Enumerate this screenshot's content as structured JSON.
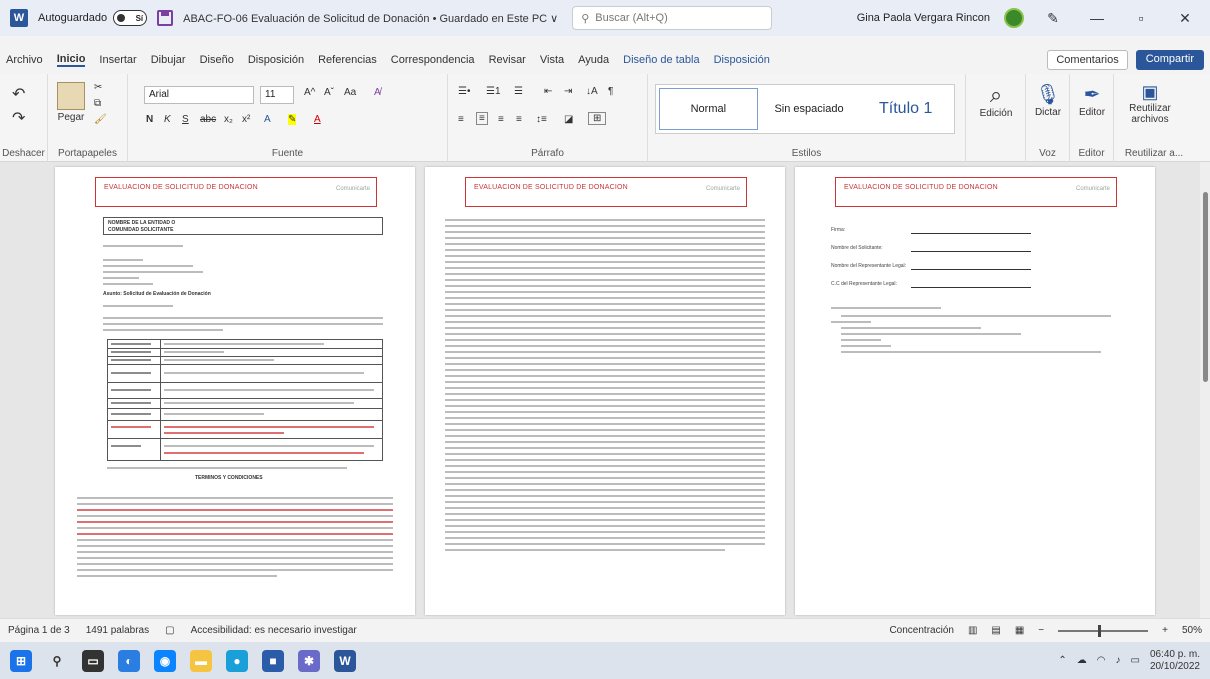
{
  "titlebar": {
    "autosave_label": "Autoguardado",
    "autosave_state": "Sí",
    "document_title": "ABAC-FO-06 Evaluación de Solicitud de Donación • Guardado en Este PC ∨",
    "search_placeholder": "Buscar (Alt+Q)",
    "user_name": "Gina Paola Vergara Rincon"
  },
  "menu": {
    "items": [
      "Archivo",
      "Inicio",
      "Insertar",
      "Dibujar",
      "Diseño",
      "Disposición",
      "Referencias",
      "Correspondencia",
      "Revisar",
      "Vista",
      "Ayuda",
      "Diseño de tabla",
      "Disposición"
    ],
    "comments_label": "Comentarios",
    "share_label": "Compartir"
  },
  "ribbon": {
    "undo_label": "Deshacer",
    "paste_label": "Pegar",
    "clipboard_label": "Portapapeles",
    "font_name": "Arial",
    "font_size": "11",
    "font_group_label": "Fuente",
    "paragraph_label": "Párrafo",
    "styles": [
      "Normal",
      "Sin espaciado",
      "Título 1"
    ],
    "styles_label": "Estilos",
    "edit_label": "Edición",
    "dictate_label": "Dictar",
    "voice_label": "Voz",
    "editor_label": "Editor",
    "editor_group_label": "Editor",
    "reuse_label": "Reutilizar archivos",
    "reuse_group_label": "Reutilizar a..."
  },
  "pages": {
    "header_title": "EVALUACION DE SOLICITUD DE DONACION",
    "header_logo": "Comunicarte"
  },
  "page1": {
    "table_top_line1": "NOMBRE DE LA ENTIDAD O",
    "table_top_line2": "COMUNIDAD SOLICITANTE",
    "subject": "Asunto: Solicitud de Evaluación de Donación",
    "terms_title": "TERMINOS Y CONDICIONES"
  },
  "page3": {
    "fields": [
      "Firma:",
      "Nombre del Solicitante:",
      "Nombre del Representante Legal:",
      "C.C del Representante Legal:"
    ]
  },
  "statusbar": {
    "page_info": "Página 1 de 3",
    "word_count": "1491 palabras",
    "accessibility": "Accesibilidad: es necesario investigar",
    "focus_label": "Concentración",
    "zoom": "50%"
  },
  "taskbar": {
    "time": "06:40 p. m.",
    "date": "20/10/2022"
  }
}
